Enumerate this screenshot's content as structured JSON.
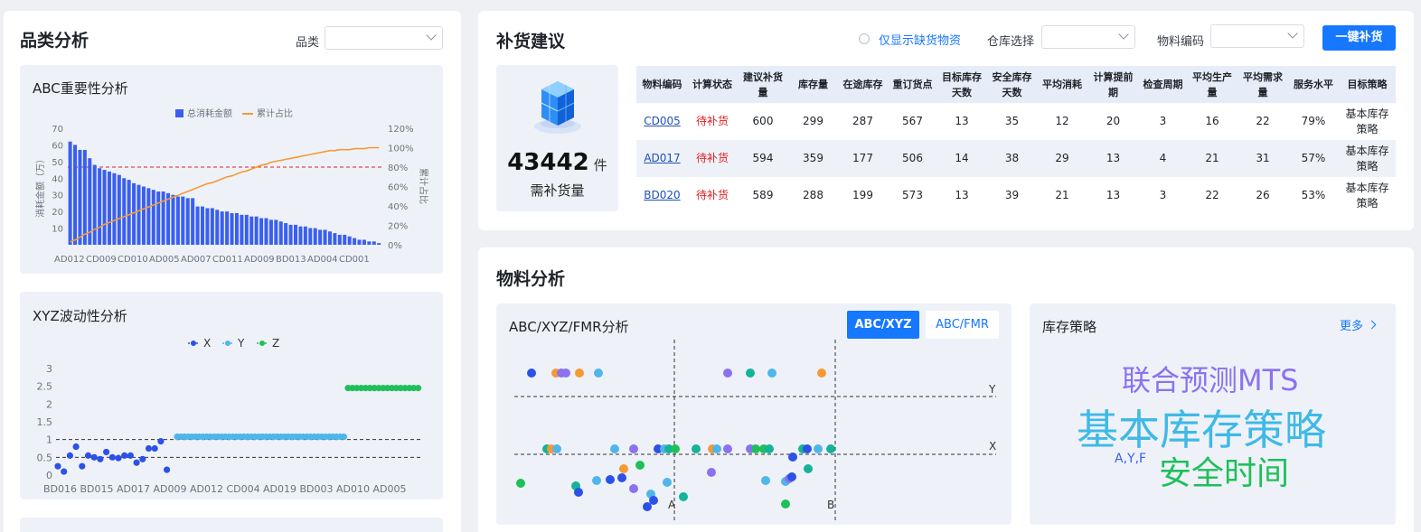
{
  "category_panel": {
    "title": "品类分析",
    "filter_label": "品类",
    "filter_value": "",
    "abc": {
      "title": "ABC重要性分析",
      "legend_bar": "总消耗金额",
      "legend_line": "累计占比",
      "ylabel_left": "消耗金额（万）",
      "ylabel_right": "累计占比"
    },
    "xyz": {
      "title": "XYZ波动性分析",
      "legend": [
        "X",
        "Y",
        "Z"
      ]
    }
  },
  "replenish_panel": {
    "title": "补货建议",
    "only_shortage_label": "仅显示缺货物资",
    "warehouse_label": "仓库选择",
    "warehouse_value": "",
    "material_label": "物料编码",
    "material_value": "",
    "one_click_label": "一键补货",
    "summary_number": "43442",
    "summary_unit": "件",
    "summary_label": "需补货量",
    "columns": [
      "物料编码",
      "计算状态",
      "建议补货量",
      "库存量",
      "在途库存",
      "重订货点",
      "目标库存天数",
      "安全库存天数",
      "平均消耗",
      "计算提前期",
      "检查周期",
      "平均生产量",
      "平均需求量",
      "服务水平",
      "目标策略"
    ],
    "rows": [
      [
        "CD005",
        "待补货",
        "600",
        "299",
        "287",
        "567",
        "13",
        "35",
        "12",
        "20",
        "3",
        "16",
        "22",
        "79%",
        "基本库存策略"
      ],
      [
        "AD017",
        "待补货",
        "594",
        "359",
        "177",
        "506",
        "14",
        "38",
        "29",
        "13",
        "4",
        "21",
        "31",
        "57%",
        "基本库存策略"
      ],
      [
        "BD020",
        "待补货",
        "589",
        "288",
        "199",
        "573",
        "13",
        "39",
        "21",
        "13",
        "3",
        "22",
        "26",
        "53%",
        "基本库存策略"
      ]
    ]
  },
  "material_panel": {
    "title": "物料分析",
    "matrix": {
      "title": "ABC/XYZ/FMR分析",
      "tab_active": "ABC/XYZ",
      "tab_inactive": "ABC/FMR",
      "line_y": "Y",
      "line_x": "X",
      "line_a": "A",
      "line_b": "B"
    },
    "strategy": {
      "title": "库存策略",
      "more_label": "更多",
      "words": [
        "联合预测MTS",
        "基本库存策略",
        "A,Y,F",
        "安全时间"
      ]
    }
  },
  "colors": {
    "primary": "#1677ff",
    "bar": "#3a5ff0",
    "line": "#f59a35",
    "danger": "#e02020",
    "x_series": "#2c51e8",
    "y_series": "#4fb6ea",
    "z_series": "#1fbf5a",
    "purple": "#8a72f0",
    "teal": "#14b39a"
  },
  "chart_data": [
    {
      "type": "bar",
      "title": "ABC重要性分析",
      "ylabel": "消耗金额（万）",
      "y2label": "累计占比",
      "ylim": [
        0,
        70
      ],
      "y2lim": [
        0,
        120
      ],
      "yticks": [
        10,
        20,
        30,
        40,
        50,
        60,
        70
      ],
      "y2ticks": [
        "0%",
        "20%",
        "40%",
        "60%",
        "80%",
        "100%",
        "120%"
      ],
      "xtick_labels": [
        "AD012",
        "CD009",
        "CD010",
        "AD005",
        "AD007",
        "CD011",
        "AD009",
        "BD013",
        "AD004",
        "CD001"
      ],
      "series": [
        {
          "name": "总消耗金额",
          "values": [
            62,
            60,
            57,
            57,
            52,
            48,
            46,
            45,
            44,
            43,
            42,
            40,
            39,
            37,
            36,
            35,
            34,
            33,
            32,
            32,
            31,
            30,
            29,
            29,
            28,
            28,
            23,
            23,
            22,
            22,
            21,
            20,
            20,
            19,
            19,
            18,
            18,
            17,
            17,
            16,
            16,
            15,
            15,
            14,
            13,
            12,
            12,
            11,
            11,
            10,
            10,
            9,
            9,
            8,
            7,
            6,
            6,
            5,
            4,
            3,
            3,
            2,
            2,
            1
          ]
        },
        {
          "name": "累计占比",
          "type": "line",
          "values": [
            3,
            5,
            8,
            11,
            13,
            16,
            18,
            21,
            23,
            25,
            27,
            29,
            31,
            33,
            35,
            37,
            39,
            41,
            43,
            45,
            47,
            49,
            51,
            53,
            55,
            57,
            59,
            61,
            63,
            64,
            66,
            68,
            70,
            71,
            73,
            75,
            76,
            78,
            80,
            82,
            83,
            85,
            86,
            87,
            88,
            89,
            90,
            91,
            92,
            93,
            94,
            95,
            96,
            97,
            97,
            98,
            98,
            98,
            99,
            99,
            99,
            100,
            100,
            100
          ]
        }
      ],
      "threshold_80": 80
    },
    {
      "type": "scatter",
      "title": "XYZ波动性分析",
      "ylim": [
        0,
        3
      ],
      "yticks": [
        0,
        0.5,
        1,
        1.5,
        2,
        2.5,
        3
      ],
      "xtick_labels": [
        "BD016",
        "BD015",
        "AD017",
        "AD009",
        "AD012",
        "CD004",
        "AD019",
        "BD003",
        "AD010",
        "AD005"
      ],
      "reference_lines": [
        0.5,
        1
      ],
      "series": [
        {
          "name": "X",
          "values": [
            0.25,
            0.1,
            0.55,
            0.8,
            0.25,
            0.55,
            0.5,
            0.45,
            0.65,
            0.5,
            0.48,
            0.55,
            0.55,
            0.35,
            0.45,
            0.75,
            0.75,
            0.95,
            0.15
          ]
        },
        {
          "name": "Y",
          "values": [
            1.08,
            1.08,
            1.08,
            1.08,
            1.08,
            1.08,
            1.08,
            1.08,
            1.08,
            1.08,
            1.08,
            1.08,
            1.08,
            1.08,
            1.08,
            1.08,
            1.08,
            1.08,
            1.08,
            1.08,
            1.08,
            1.08,
            1.08,
            1.08,
            1.08,
            1.08,
            1.08,
            1.08,
            1.08,
            1.08,
            1.08,
            1.08,
            1.08,
            1.08,
            1.08,
            1.08,
            1.08,
            1.08,
            1.08,
            1.08,
            1.08,
            1.08,
            1.08,
            1.08,
            1.08,
            1.08
          ]
        },
        {
          "name": "Z",
          "values": [
            2.45,
            2.45,
            2.45,
            2.45,
            2.45,
            2.45,
            2.45,
            2.45,
            2.45,
            2.45,
            2.45,
            2.45,
            2.45,
            2.45,
            2.45,
            2.45,
            2.45
          ]
        }
      ]
    }
  ]
}
